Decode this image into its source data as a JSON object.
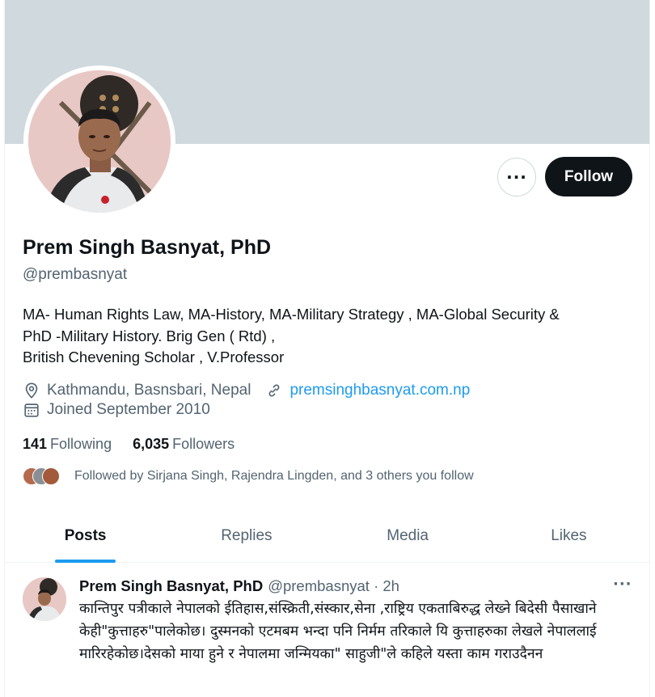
{
  "profile": {
    "name": "Prem Singh Basnyat, PhD",
    "handle": "@prembasnyat",
    "bio": "MA- Human Rights Law, MA-History, MA-Military Strategy , MA-Global Security &\nPhD -Military History.  Brig Gen ( Rtd) ,\nBritish Chevening Scholar , V.Professor",
    "location": "Kathmandu, Basnsbari, Nepal",
    "website": "premsinghbasnyat.com.np",
    "joined": "Joined September 2010",
    "following_count": "141",
    "following_label": "Following",
    "followers_count": "6,035",
    "followers_label": "Followers",
    "followed_by": "Followed by Sirjana Singh, Rajendra Lingden, and 3 others you follow"
  },
  "actions": {
    "more_label": "···",
    "follow_label": "Follow"
  },
  "tabs": [
    {
      "label": "Posts",
      "active": true
    },
    {
      "label": "Replies",
      "active": false
    },
    {
      "label": "Media",
      "active": false
    },
    {
      "label": "Likes",
      "active": false
    }
  ],
  "post": {
    "author": "Prem Singh Basnyat, PhD",
    "meta": "@prembasnyat · 2h",
    "more_label": "···",
    "text": "कान्तिपुर पत्रीकाले नेपालको ईतिहास,संस्क्रिती,संस्कार,सेना ,राष्ट्रिय एकताबिरुद्ध लेख्ने बिदेसी पैसाखाने केही\"कुत्ताहरु\"पालेकोछ। दुस्मनको एटमबम भन्दा पनि निर्मम तरिकाले यि कुत्ताहरुका लेखले नेपाललाई मारिरहेकोछ।देसको माया हुने र नेपालमा जन्मियका\" साहुजी\"ले कहिले यस्ता काम गराउदैनन"
  },
  "colors": {
    "banner": "#cfd9de",
    "accent": "#1d9bf0",
    "text_primary": "#0f1419",
    "text_secondary": "#536471",
    "follow_bg": "#0f1419"
  },
  "icons": [
    "more-icon",
    "location-icon",
    "link-icon",
    "calendar-icon"
  ]
}
